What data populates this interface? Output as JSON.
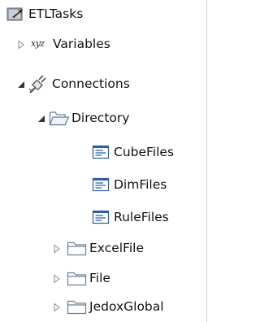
{
  "tree": {
    "root": {
      "label": "ETLTasks",
      "icon": "etl-tasks-icon"
    },
    "variables": {
      "label": "Variables",
      "badge": "xyz",
      "expanded": false
    },
    "connections": {
      "label": "Connections",
      "icon": "connections-plug-icon",
      "expanded": true
    },
    "directory": {
      "label": "Directory",
      "icon": "folder-open-icon",
      "expanded": true
    },
    "directory_children": [
      {
        "label": "CubeFiles",
        "icon": "file-connection-icon"
      },
      {
        "label": "DimFiles",
        "icon": "file-connection-icon"
      },
      {
        "label": "RuleFiles",
        "icon": "file-connection-icon"
      }
    ],
    "folders": [
      {
        "label": "ExcelFile",
        "icon": "folder-icon",
        "expanded": false
      },
      {
        "label": "File",
        "icon": "folder-icon",
        "expanded": false
      },
      {
        "label": "JedoxGlobal",
        "icon": "folder-icon",
        "expanded": false
      }
    ]
  },
  "colors": {
    "folder_stroke": "#6b7f98",
    "folder_fill": "#eef2f7",
    "arrow_collapsed": "#8a8a8a",
    "arrow_expanded": "#333333",
    "file_icon_stroke": "#2f5f9e"
  }
}
